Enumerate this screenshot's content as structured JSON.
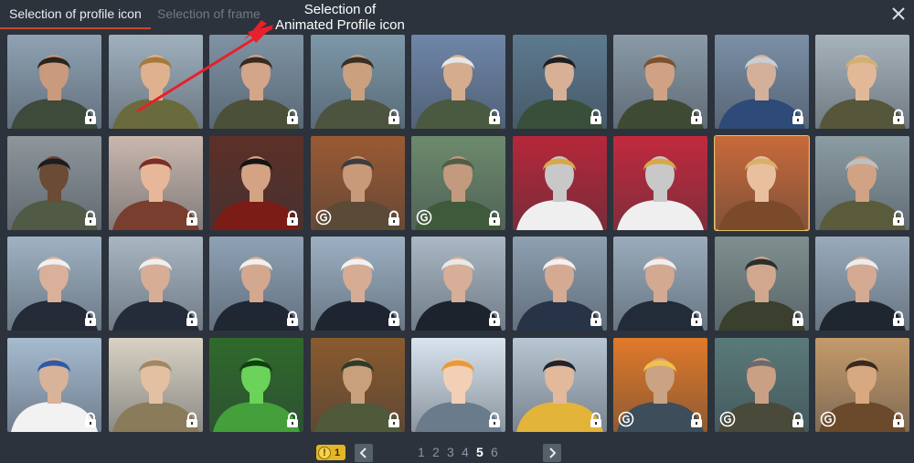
{
  "tabs": [
    {
      "label": "Selection of profile icon",
      "active": true
    },
    {
      "label": "Selection of frame",
      "active": false
    }
  ],
  "annotation": {
    "line1": "Selection of",
    "line2": "Animated Profile icon",
    "color": "#ffffff",
    "arrow_color": "#e8202a"
  },
  "grid": {
    "rows": [
      [
        {
          "subject": "female jet pilot",
          "badge": "lock"
        },
        {
          "subject": "female pilot smiling",
          "badge": "none"
        },
        {
          "subject": "female pilot short hair",
          "badge": "lock"
        },
        {
          "subject": "young male pilot",
          "badge": "lock"
        },
        {
          "subject": "pilot in white helmet",
          "badge": "lock"
        },
        {
          "subject": "female pilot dark hair",
          "badge": "lock"
        },
        {
          "subject": "female pilot green jacket",
          "badge": "lock"
        },
        {
          "subject": "pilot in blue helmet",
          "badge": "lock"
        },
        {
          "subject": "blonde female pilot",
          "badge": "lock"
        }
      ],
      [
        {
          "subject": "female pilot shark-mouth aircraft",
          "badge": "lock"
        },
        {
          "subject": "pin-up aviator",
          "badge": "lock"
        },
        {
          "subject": "guard with bearskin hat",
          "badge": "lock"
        },
        {
          "subject": "tank crewman goggles",
          "badge": "gold-lock"
        },
        {
          "subject": "tank crewman green",
          "badge": "gold-lock"
        },
        {
          "subject": "android red stripes",
          "badge": "none"
        },
        {
          "subject": "android gold jacket",
          "badge": "none"
        },
        {
          "subject": "woman on motorcycle",
          "badge": "none",
          "selected": true
        },
        {
          "subject": "crewman with binoculars",
          "badge": "lock"
        }
      ],
      [
        {
          "subject": "sailor white cap",
          "badge": "lock"
        },
        {
          "subject": "sailor moustache",
          "badge": "lock"
        },
        {
          "subject": "sailor striped shirt",
          "badge": "lock"
        },
        {
          "subject": "naval officer",
          "badge": "lock"
        },
        {
          "subject": "naval officer peaked cap",
          "badge": "lock"
        },
        {
          "subject": "sailor on deck",
          "badge": "lock"
        },
        {
          "subject": "sailor cap ribbon",
          "badge": "lock"
        },
        {
          "subject": "naval officer coat",
          "badge": "lock"
        },
        {
          "subject": "naval officer dark uniform",
          "badge": "lock"
        }
      ],
      [
        {
          "subject": "admiral white uniform",
          "badge": "lock"
        },
        {
          "subject": "female aviator vintage",
          "badge": "lock"
        },
        {
          "subject": "night vision soldier",
          "badge": "lock"
        },
        {
          "subject": "jet pilot oxygen mask",
          "badge": "lock"
        },
        {
          "subject": "female pilot colorful",
          "badge": "lock"
        },
        {
          "subject": "naval captain yellow coat",
          "badge": "lock"
        },
        {
          "subject": "pilot explosion",
          "badge": "gold-lock"
        },
        {
          "subject": "pilot leather helmet",
          "badge": "gold-lock"
        },
        {
          "subject": "aviator goggles",
          "badge": "gold-lock"
        }
      ]
    ]
  },
  "pager": {
    "currency": {
      "symbol": "!",
      "count": "1"
    },
    "pages": [
      "1",
      "2",
      "3",
      "4",
      "5",
      "6"
    ],
    "current": "5"
  },
  "colors": {
    "background": "#2c333c",
    "tab_underline": "#c9472f",
    "selected_outline": "#e0c36d",
    "currency_bg": "#e3b626"
  }
}
